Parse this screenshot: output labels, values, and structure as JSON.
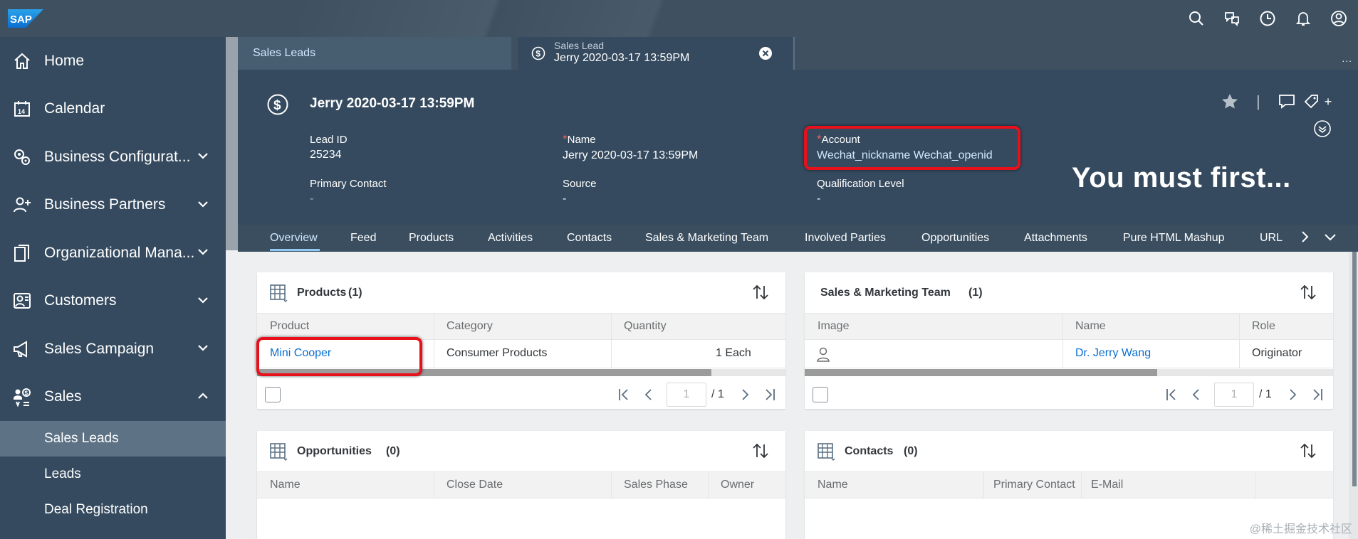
{
  "shell": {
    "logo": "SAP",
    "icons": [
      "search-icon",
      "chat-icon",
      "clock-icon",
      "bell-icon",
      "user-icon"
    ]
  },
  "sidebar": {
    "items": [
      {
        "label": "Home",
        "icon": "home-icon"
      },
      {
        "label": "Calendar",
        "icon": "calendar-icon"
      },
      {
        "label": "Business Configurat...",
        "icon": "gears-icon"
      },
      {
        "label": "Business Partners",
        "icon": "partners-icon"
      },
      {
        "label": "Organizational Mana...",
        "icon": "org-icon"
      },
      {
        "label": "Customers",
        "icon": "customers-icon"
      },
      {
        "label": "Sales Campaign",
        "icon": "megaphone-icon"
      },
      {
        "label": "Sales",
        "icon": "sales-icon"
      }
    ],
    "sub_items": [
      {
        "label": "Sales Leads",
        "active": true
      },
      {
        "label": "Leads",
        "active": false
      },
      {
        "label": "Deal Registration",
        "active": false
      }
    ]
  },
  "tabs": {
    "tab1": "Sales Leads",
    "tab2_sub": "Sales Lead",
    "tab2_main": "Jerry 2020-03-17 13:59PM",
    "more": "..."
  },
  "header": {
    "title": "Jerry 2020-03-17 13:59PM",
    "divider": "|",
    "plus": "+",
    "fields": {
      "lead_id_label": "Lead ID",
      "lead_id": "25234",
      "name_label": "Name",
      "name": "Jerry 2020-03-17 13:59PM",
      "account_label": "Account",
      "account": "Wechat_nickname Wechat_openid",
      "primary_contact_label": "Primary Contact",
      "primary_contact": "-",
      "source_label": "Source",
      "source": "-",
      "qualification_label": "Qualification Level",
      "qualification": "-"
    },
    "required_mark": "*",
    "overlay": "You must first..."
  },
  "subtabs": [
    "Overview",
    "Feed",
    "Products",
    "Activities",
    "Contacts",
    "Sales & Marketing Team",
    "Involved Parties",
    "Opportunities",
    "Attachments",
    "Pure HTML Mashup",
    "URL"
  ],
  "products": {
    "title": "Products",
    "count": "(1)",
    "columns": [
      "Product",
      "Category",
      "Quantity"
    ],
    "rows": [
      {
        "product": "Mini Cooper",
        "category": "Consumer Products",
        "quantity": "1 Each"
      }
    ],
    "page": "1",
    "total": "/ 1"
  },
  "team": {
    "title": "Sales & Marketing Team",
    "count": "(1)",
    "columns": [
      "Image",
      "Name",
      "Role"
    ],
    "rows": [
      {
        "name": "Dr. Jerry Wang",
        "role": "Originator"
      }
    ],
    "page": "1",
    "total": "/ 1"
  },
  "opportunities": {
    "title": "Opportunities",
    "count": "(0)",
    "columns": [
      "Name",
      "Close Date",
      "Sales Phase",
      "Owner"
    ]
  },
  "contacts": {
    "title": "Contacts",
    "count": "(0)",
    "columns": [
      "Name",
      "Primary Contact",
      "E-Mail"
    ]
  },
  "watermark": "@稀土掘金技术社区",
  "colors": {
    "shell": "#3f5161",
    "sidebar": "#354a5f",
    "link": "#0a6ed1",
    "highlight": "#e8101a"
  }
}
